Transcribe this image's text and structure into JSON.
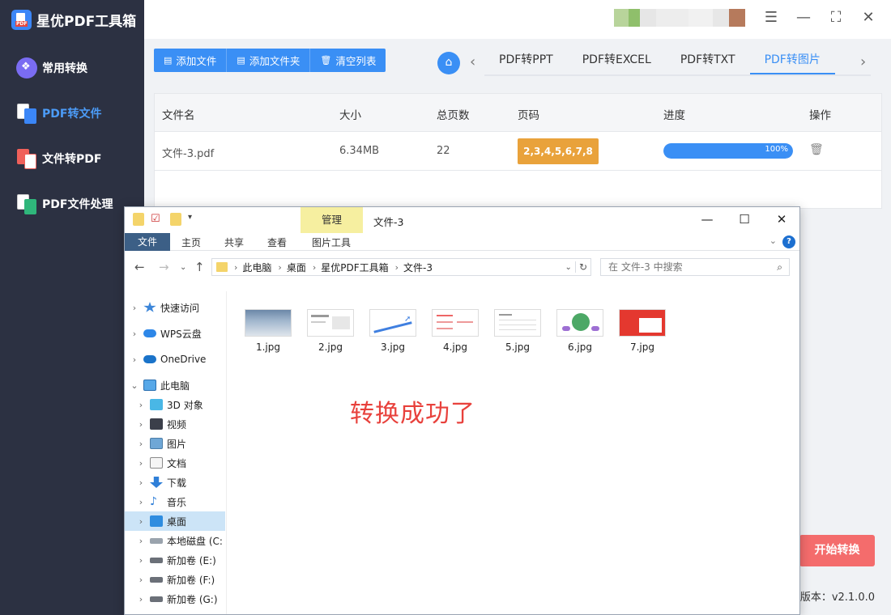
{
  "app": {
    "title": "星优PDF工具箱",
    "version": "版本：v2.1.0.0",
    "start_button": "开始转换"
  },
  "sidebar": {
    "items": [
      {
        "label": "常用转换",
        "icon": "grid-icon",
        "active": false
      },
      {
        "label": "PDF转文件",
        "icon": "pdf-to-file-icon",
        "active": true
      },
      {
        "label": "文件转PDF",
        "icon": "file-to-pdf-icon",
        "active": false
      },
      {
        "label": "PDF文件处理",
        "icon": "pdf-process-icon",
        "active": false
      }
    ]
  },
  "toolbar": {
    "add_file": "添加文件",
    "add_folder": "添加文件夹",
    "clear_list": "清空列表"
  },
  "tabs": [
    {
      "label": "PDF转PPT",
      "active": false
    },
    {
      "label": "PDF转EXCEL",
      "active": false
    },
    {
      "label": "PDF转TXT",
      "active": false
    },
    {
      "label": "PDF转图片",
      "active": true
    }
  ],
  "table": {
    "headers": [
      "文件名",
      "大小",
      "总页数",
      "页码",
      "进度",
      "操作"
    ],
    "rows": [
      {
        "name": "文件-3.pdf",
        "size": "6.34MB",
        "pages": "22",
        "page_range": "2,3,4,5,6,7,8",
        "progress": "100%",
        "progress_value": 100
      }
    ]
  },
  "explorer": {
    "window_title": "文件-3",
    "context_tab": "管理",
    "ribbon_tabs": [
      "文件",
      "主页",
      "共享",
      "查看",
      "图片工具"
    ],
    "breadcrumb": [
      "此电脑",
      "桌面",
      "星优PDF工具箱",
      "文件-3"
    ],
    "search_placeholder": "在 文件-3 中搜索",
    "nav_items": [
      {
        "label": "快速访问",
        "icon": "star-icon"
      },
      {
        "label": "WPS云盘",
        "icon": "cloud-icon"
      },
      {
        "label": "OneDrive",
        "icon": "onedrive-icon"
      },
      {
        "label": "此电脑",
        "icon": "computer-icon"
      },
      {
        "label": "3D 对象",
        "icon": "cube-icon"
      },
      {
        "label": "视频",
        "icon": "video-icon"
      },
      {
        "label": "图片",
        "icon": "picture-icon"
      },
      {
        "label": "文档",
        "icon": "document-icon"
      },
      {
        "label": "下载",
        "icon": "download-icon"
      },
      {
        "label": "音乐",
        "icon": "music-icon"
      },
      {
        "label": "桌面",
        "icon": "desktop-icon"
      },
      {
        "label": "本地磁盘 (C:",
        "icon": "drive-icon"
      },
      {
        "label": "新加卷 (E:)",
        "icon": "drive-icon"
      },
      {
        "label": "新加卷 (F:)",
        "icon": "drive-icon"
      },
      {
        "label": "新加卷 (G:)",
        "icon": "drive-icon"
      }
    ],
    "files": [
      "1.jpg",
      "2.jpg",
      "3.jpg",
      "4.jpg",
      "5.jpg",
      "6.jpg",
      "7.jpg"
    ],
    "success_message": "转换成功了"
  },
  "colors": {
    "accent": "#3a8ff5",
    "sidebar_bg": "#2c3142",
    "badge": "#e9a23b",
    "start_button": "#f46c6c",
    "success_text": "#e8413c"
  }
}
